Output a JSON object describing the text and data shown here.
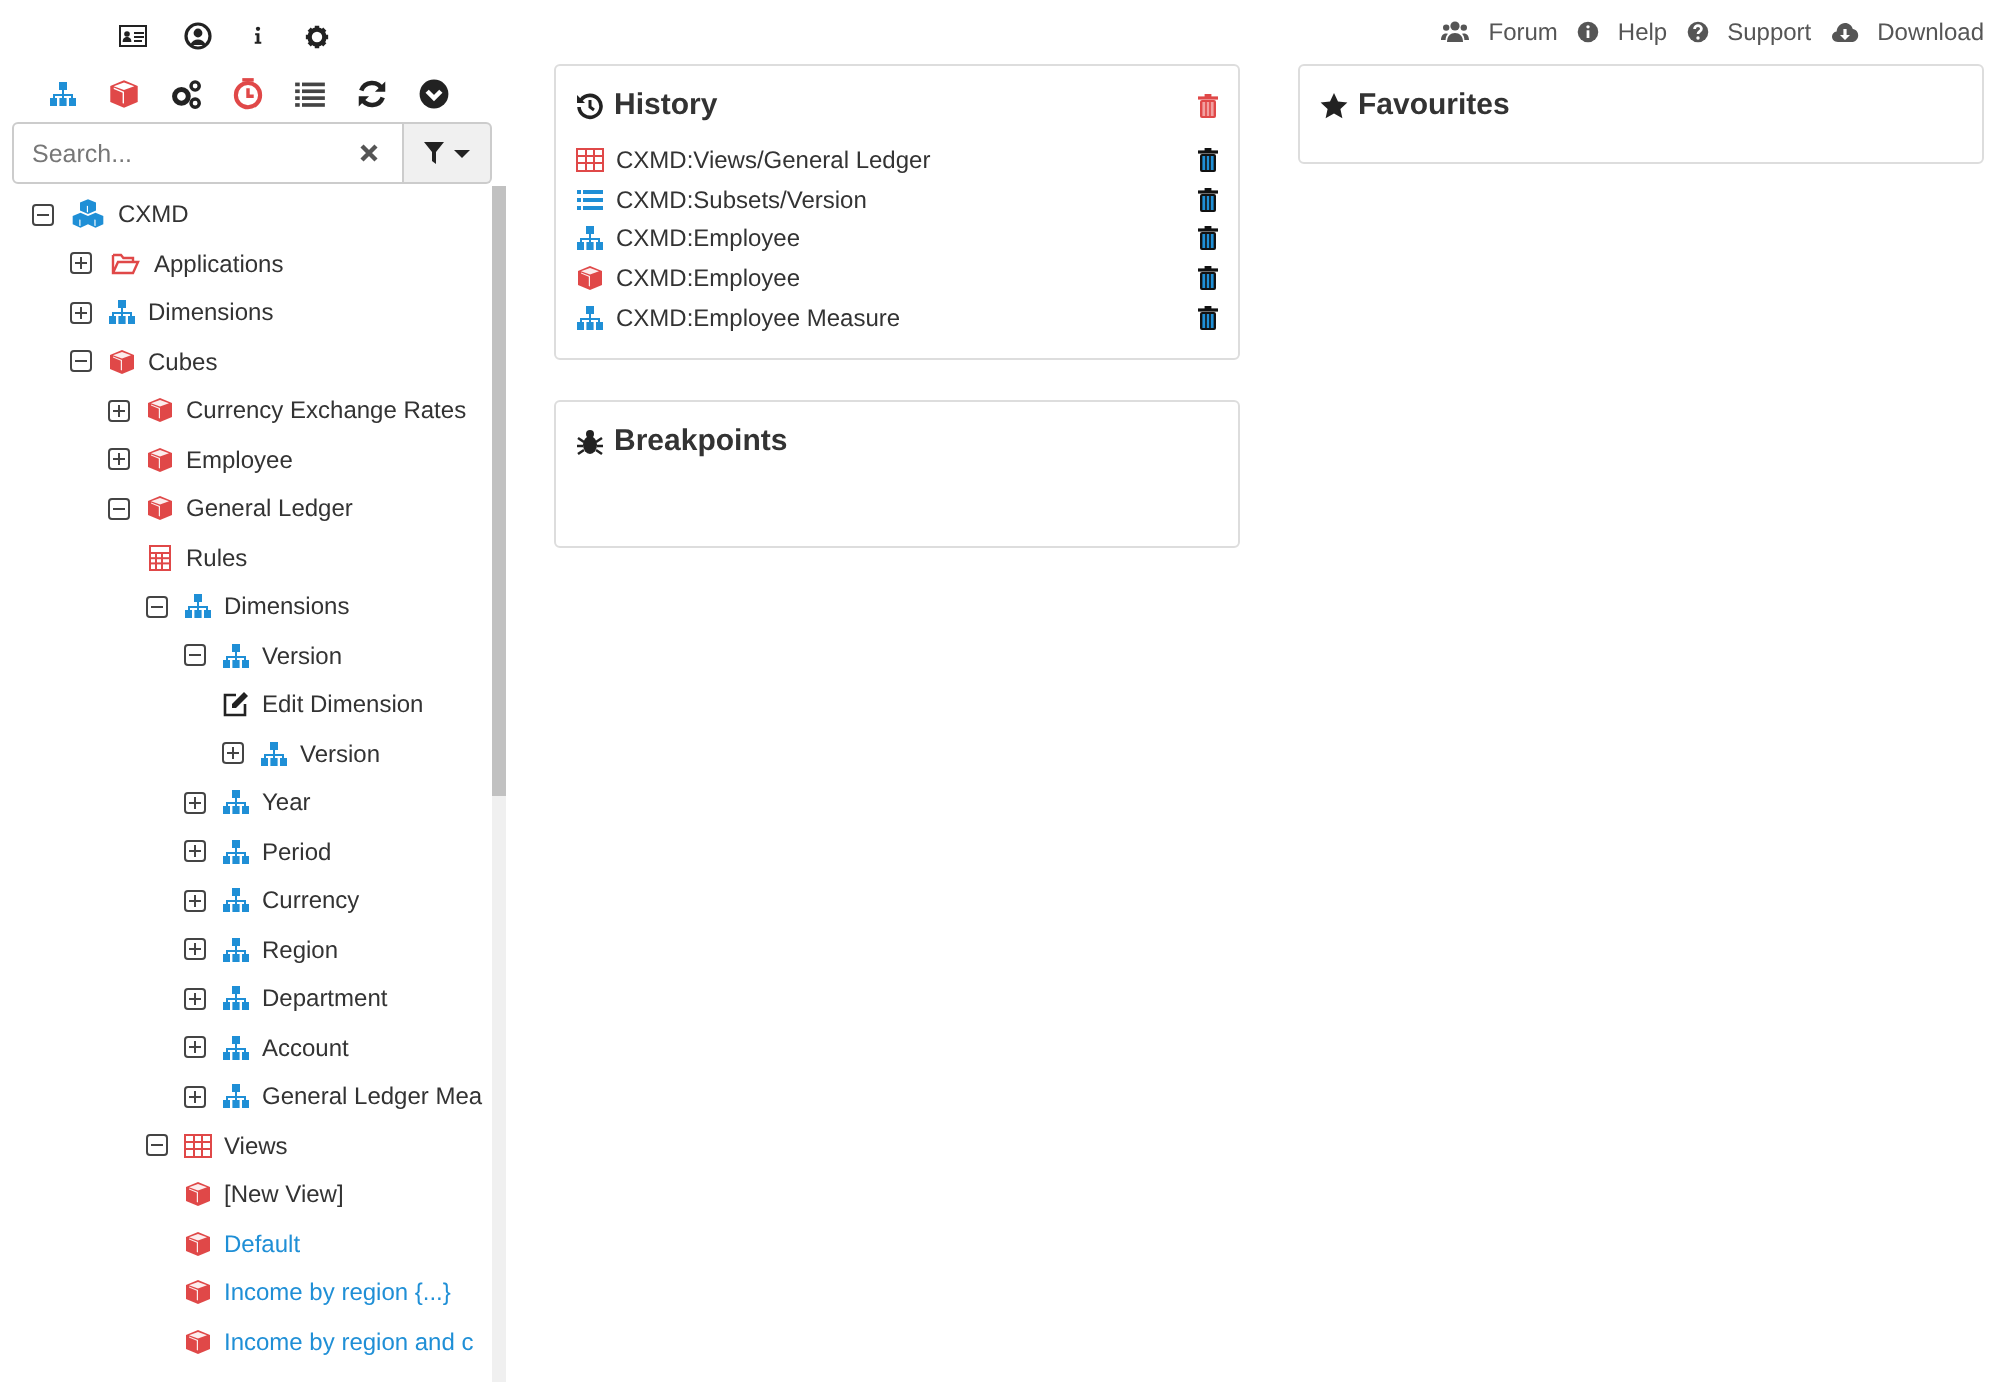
{
  "search": {
    "placeholder": "Search..."
  },
  "tree": [
    {
      "label": "CXMD",
      "kind": "cubes",
      "expanded": true,
      "children": [
        {
          "label": "Applications",
          "kind": "folder",
          "expanded": false
        },
        {
          "label": "Dimensions",
          "kind": "hierarchy",
          "expanded": false
        },
        {
          "label": "Cubes",
          "kind": "cube",
          "expanded": true,
          "children": [
            {
              "label": "Currency Exchange Rates",
              "kind": "cube",
              "expanded": false
            },
            {
              "label": "Employee",
              "kind": "cube",
              "expanded": false
            },
            {
              "label": "General Ledger",
              "kind": "cube",
              "expanded": true,
              "children": [
                {
                  "label": "Rules",
                  "kind": "rules"
                },
                {
                  "label": "Dimensions",
                  "kind": "hierarchy",
                  "expanded": true,
                  "children": [
                    {
                      "label": "Version",
                      "kind": "hierarchy",
                      "expanded": true,
                      "children": [
                        {
                          "label": "Edit Dimension",
                          "kind": "edit"
                        },
                        {
                          "label": "Version",
                          "kind": "hierarchy",
                          "expanded": false
                        }
                      ]
                    },
                    {
                      "label": "Year",
                      "kind": "hierarchy",
                      "expanded": false
                    },
                    {
                      "label": "Period",
                      "kind": "hierarchy",
                      "expanded": false
                    },
                    {
                      "label": "Currency",
                      "kind": "hierarchy",
                      "expanded": false
                    },
                    {
                      "label": "Region",
                      "kind": "hierarchy",
                      "expanded": false
                    },
                    {
                      "label": "Department",
                      "kind": "hierarchy",
                      "expanded": false
                    },
                    {
                      "label": "Account",
                      "kind": "hierarchy",
                      "expanded": false
                    },
                    {
                      "label": "General Ledger Mea",
                      "kind": "hierarchy",
                      "expanded": false
                    }
                  ]
                },
                {
                  "label": "Views",
                  "kind": "table",
                  "expanded": true,
                  "children": [
                    {
                      "label": "[New View]",
                      "kind": "cube",
                      "link": false
                    },
                    {
                      "label": "Default",
                      "kind": "cube",
                      "link": true
                    },
                    {
                      "label": "Income by region {...}",
                      "kind": "cube",
                      "link": true
                    },
                    {
                      "label": "Income by region and c",
                      "kind": "cube",
                      "link": true
                    }
                  ]
                }
              ]
            }
          ]
        }
      ]
    }
  ],
  "top_links": [
    {
      "label": "Forum",
      "kind": "users"
    },
    {
      "label": "Help",
      "kind": "info"
    },
    {
      "label": "Support",
      "kind": "question"
    },
    {
      "label": "Download",
      "kind": "download"
    }
  ],
  "history": {
    "title": "History",
    "items": [
      {
        "label": "CXMD:Views/General Ledger",
        "kind": "table"
      },
      {
        "label": "CXMD:Subsets/Version",
        "kind": "list"
      },
      {
        "label": "CXMD:Employee",
        "kind": "hierarchy"
      },
      {
        "label": "CXMD:Employee",
        "kind": "cube"
      },
      {
        "label": "CXMD:Employee Measure",
        "kind": "hierarchy"
      }
    ]
  },
  "breakpoints": {
    "title": "Breakpoints"
  },
  "favourites": {
    "title": "Favourites"
  }
}
